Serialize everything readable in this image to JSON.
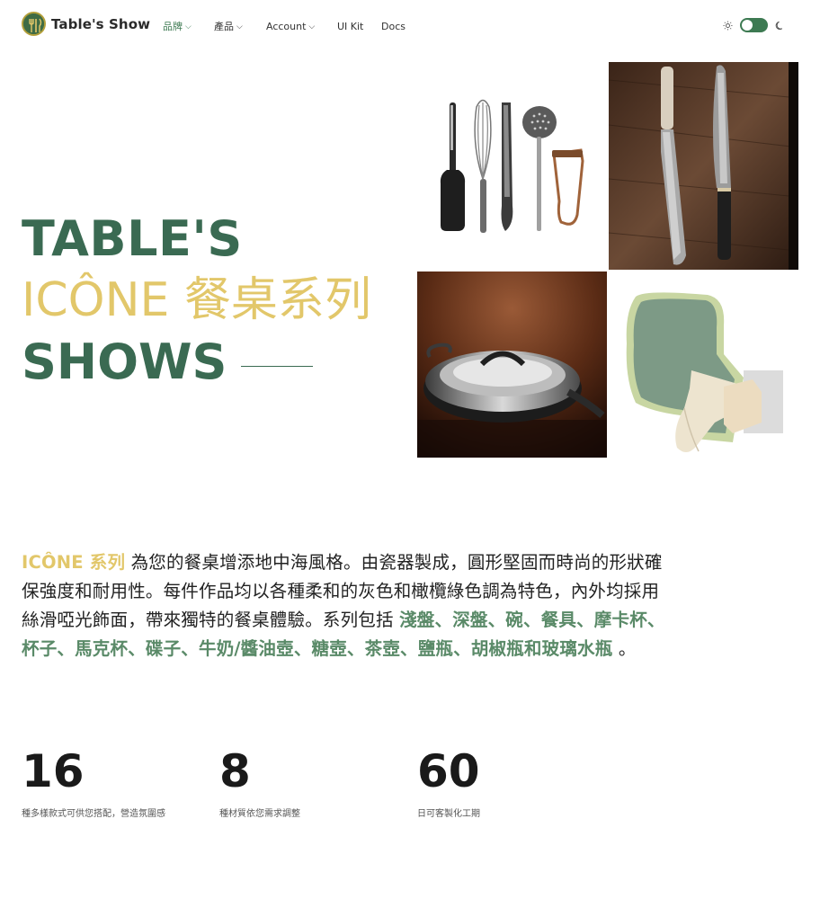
{
  "header": {
    "brand_name": "Table's Show",
    "nav": [
      {
        "label": "品牌",
        "has_dropdown": true,
        "active": true
      },
      {
        "label": "產品",
        "has_dropdown": true,
        "active": false
      },
      {
        "label": "Account",
        "has_dropdown": true,
        "active": false
      },
      {
        "label": "UI Kit",
        "has_dropdown": false,
        "active": false
      },
      {
        "label": "Docs",
        "has_dropdown": false,
        "active": false
      }
    ],
    "theme_toggle_icons": [
      "sun-icon",
      "moon-icon"
    ]
  },
  "hero": {
    "line1": "TABLE'S",
    "line2": "ICÔNE 餐桌系列",
    "line3": "SHOWS"
  },
  "description": {
    "accent": "ICÔNE 系列",
    "text_before_items": " 為您的餐桌增添地中海風格。由瓷器製成，圓形堅固而時尚的形狀確保強度和耐用性。每件作品均以各種柔和的灰色和橄欖綠色調為特色，內外均採用絲滑啞光飾面，帶來獨特的餐桌體驗。系列包括 ",
    "items": "淺盤、深盤、碗、餐具、摩卡杯、杯子、馬克杯、碟子、牛奶/醬油壺、糖壺、茶壺、鹽瓶、胡椒瓶和玻璃水瓶",
    "text_after_items": " 。"
  },
  "stats": [
    {
      "number": "16",
      "label": "種多樣款式可供您搭配，營造氛圍感"
    },
    {
      "number": "8",
      "label": "種材質依您需求調整"
    },
    {
      "number": "60",
      "label": "日可客製化工期"
    }
  ],
  "colors": {
    "brand_green": "#3a6a52",
    "accent_gold": "#e2c76a",
    "item_green": "#5a8a68",
    "toggle_green": "#3d7a52"
  }
}
